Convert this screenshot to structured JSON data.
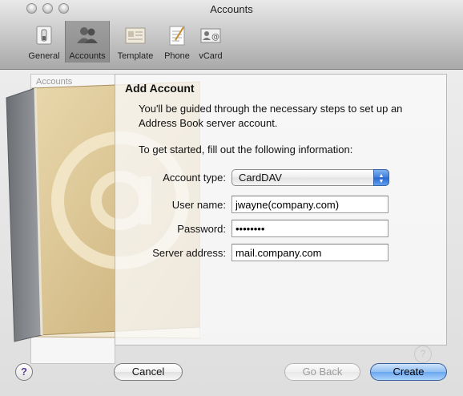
{
  "window": {
    "title": "Accounts"
  },
  "toolbar": {
    "items": [
      {
        "label": "General",
        "icon": "general-switch-icon"
      },
      {
        "label": "Accounts",
        "icon": "accounts-people-icon",
        "selected": true
      },
      {
        "label": "Template",
        "icon": "template-card-icon"
      },
      {
        "label": "Phone",
        "icon": "phone-notepad-icon"
      },
      {
        "label": "vCard",
        "icon": "vcard-icon"
      }
    ]
  },
  "background": {
    "list_header": "Accounts",
    "help_glyph": "?"
  },
  "sheet": {
    "title": "Add Account",
    "description": "You'll be guided through the necessary steps to set up an Address Book server account.",
    "instruction": "To get started, fill out the following information:",
    "fields": {
      "account_type": {
        "label": "Account type:",
        "value": "CardDAV"
      },
      "user_name": {
        "label": "User name:",
        "value": "jwayne(company.com)"
      },
      "password": {
        "label": "Password:",
        "value": "••••••••"
      },
      "server_address": {
        "label": "Server address:",
        "value": "mail.company.com"
      }
    }
  },
  "buttons": {
    "help": "?",
    "cancel": "Cancel",
    "go_back": "Go Back",
    "create": "Create"
  },
  "colors": {
    "accent": "#6aa6ee",
    "help_glyph": "#5b3c93"
  }
}
